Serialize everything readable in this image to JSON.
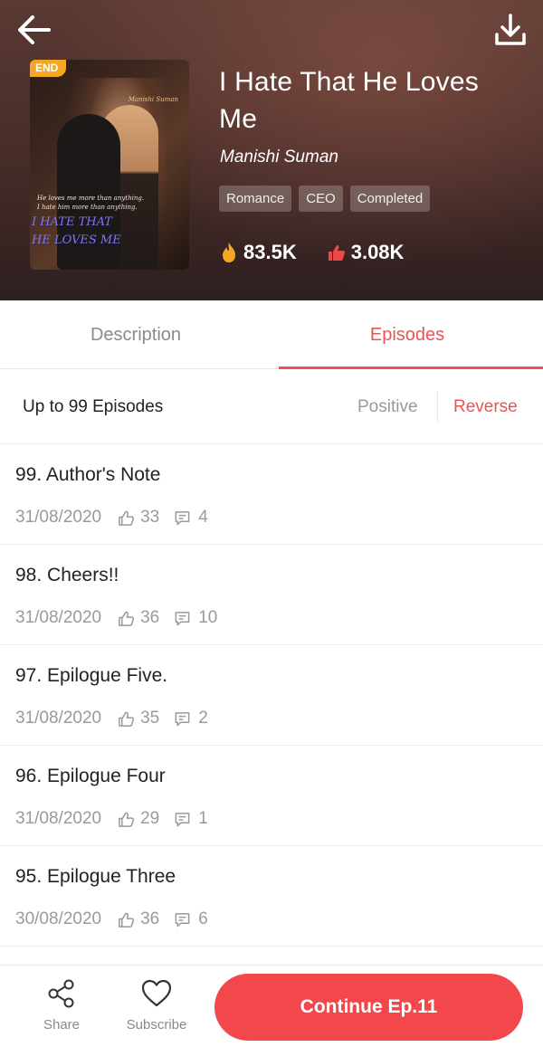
{
  "header": {
    "back_icon": "arrow-left-icon",
    "download_icon": "download-icon",
    "badge": "END",
    "title": "I Hate That He Loves Me",
    "author": "Manishi Suman",
    "tags": [
      "Romance",
      "CEO",
      "Completed"
    ],
    "views": "83.5K",
    "likes": "3.08K",
    "cover": {
      "author_tiny": "Manishi Suman",
      "tagline_line1": "He loves me more than anything.",
      "tagline_line2": "I hate him more than anything.",
      "title_line1": "I HATE THAT",
      "title_line2": "HE LOVES ME"
    }
  },
  "tabs": [
    {
      "label": "Description",
      "active": false
    },
    {
      "label": "Episodes",
      "active": true
    }
  ],
  "sort": {
    "label": "Up to 99 Episodes",
    "positive": "Positive",
    "reverse": "Reverse"
  },
  "episodes": [
    {
      "title": "99. Author's Note",
      "date": "31/08/2020",
      "likes": "33",
      "comments": "4"
    },
    {
      "title": "98. Cheers!!",
      "date": "31/08/2020",
      "likes": "36",
      "comments": "10"
    },
    {
      "title": "97. Epilogue Five.",
      "date": "31/08/2020",
      "likes": "35",
      "comments": "2"
    },
    {
      "title": "96. Epilogue Four",
      "date": "31/08/2020",
      "likes": "29",
      "comments": "1"
    },
    {
      "title": "95. Epilogue Three",
      "date": "30/08/2020",
      "likes": "36",
      "comments": "6"
    }
  ],
  "bottom_bar": {
    "share_label": "Share",
    "subscribe_label": "Subscribe",
    "continue_label": "Continue Ep.11"
  },
  "colors": {
    "accent": "#e85454",
    "button": "#f2474b",
    "badge": "#f5a623",
    "flame": "#f5a623",
    "thumb": "#f04848"
  }
}
